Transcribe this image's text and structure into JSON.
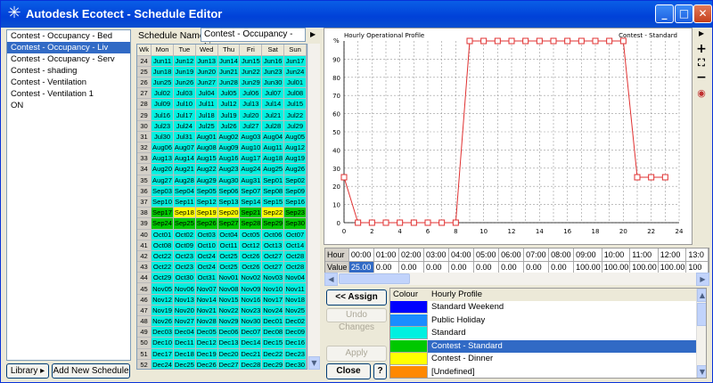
{
  "window": {
    "title": "Autodesk Ecotect - Schedule Editor"
  },
  "schedules": {
    "items": [
      "Contest - Occupancy - Bed",
      "Contest - Occupancy - Liv",
      "Contest - Occupancy - Serv",
      "Contest - shading",
      "Contest - Ventilation",
      "Contest - Ventilation 1",
      "ON"
    ],
    "selected_index": 1
  },
  "buttons": {
    "library": "Library ▸",
    "add_new": "Add New Schedule",
    "assign": "<< Assign",
    "undo": "Undo Changes",
    "apply": "Apply",
    "close": "Close",
    "help": "?"
  },
  "schedule_name": {
    "label": "Schedule Name:",
    "value": "Contest - Occupancy - Liv"
  },
  "calendar": {
    "headers": [
      "Wk",
      "Mon",
      "Tue",
      "Wed",
      "Thu",
      "Fri",
      "Sat",
      "Sun"
    ],
    "rows": [
      [
        "24",
        "Jun11",
        "Jun12",
        "Jun13",
        "Jun14",
        "Jun15",
        "Jun16",
        "Jun17"
      ],
      [
        "25",
        "Jun18",
        "Jun19",
        "Jun20",
        "Jun21",
        "Jun22",
        "Jun23",
        "Jun24"
      ],
      [
        "26",
        "Jun25",
        "Jun26",
        "Jun27",
        "Jun28",
        "Jun29",
        "Jun30",
        "Jul01"
      ],
      [
        "27",
        "Jul02",
        "Jul03",
        "Jul04",
        "Jul05",
        "Jul06",
        "Jul07",
        "Jul08"
      ],
      [
        "28",
        "Jul09",
        "Jul10",
        "Jul11",
        "Jul12",
        "Jul13",
        "Jul14",
        "Jul15"
      ],
      [
        "29",
        "Jul16",
        "Jul17",
        "Jul18",
        "Jul19",
        "Jul20",
        "Jul21",
        "Jul22"
      ],
      [
        "30",
        "Jul23",
        "Jul24",
        "Jul25",
        "Jul26",
        "Jul27",
        "Jul28",
        "Jul29"
      ],
      [
        "31",
        "Jul30",
        "Jul31",
        "Aug01",
        "Aug02",
        "Aug03",
        "Aug04",
        "Aug05"
      ],
      [
        "32",
        "Aug06",
        "Aug07",
        "Aug08",
        "Aug09",
        "Aug10",
        "Aug11",
        "Aug12"
      ],
      [
        "33",
        "Aug13",
        "Aug14",
        "Aug15",
        "Aug16",
        "Aug17",
        "Aug18",
        "Aug19"
      ],
      [
        "34",
        "Aug20",
        "Aug21",
        "Aug22",
        "Aug23",
        "Aug24",
        "Aug25",
        "Aug26"
      ],
      [
        "35",
        "Aug27",
        "Aug28",
        "Aug29",
        "Aug30",
        "Aug31",
        "Sep01",
        "Sep02"
      ],
      [
        "36",
        "Sep03",
        "Sep04",
        "Sep05",
        "Sep06",
        "Sep07",
        "Sep08",
        "Sep09"
      ],
      [
        "37",
        "Sep10",
        "Sep11",
        "Sep12",
        "Sep13",
        "Sep14",
        "Sep15",
        "Sep16"
      ],
      [
        "38",
        "Sep17",
        "Sep18",
        "Sep19",
        "Sep20",
        "Sep21",
        "Sep22",
        "Sep23"
      ],
      [
        "39",
        "Sep24",
        "Sep25",
        "Sep26",
        "Sep27",
        "Sep28",
        "Sep29",
        "Sep30"
      ],
      [
        "40",
        "Oct01",
        "Oct02",
        "Oct03",
        "Oct04",
        "Oct05",
        "Oct06",
        "Oct07"
      ],
      [
        "41",
        "Oct08",
        "Oct09",
        "Oct10",
        "Oct11",
        "Oct12",
        "Oct13",
        "Oct14"
      ],
      [
        "42",
        "Oct22",
        "Oct23",
        "Oct24",
        "Oct25",
        "Oct26",
        "Oct27",
        "Oct28"
      ],
      [
        "43",
        "Oct22",
        "Oct23",
        "Oct24",
        "Oct25",
        "Oct26",
        "Oct27",
        "Oct28"
      ],
      [
        "44",
        "Oct29",
        "Oct30",
        "Oct31",
        "Nov01",
        "Nov02",
        "Nov03",
        "Nov04"
      ],
      [
        "45",
        "Nov05",
        "Nov06",
        "Nov07",
        "Nov08",
        "Nov09",
        "Nov10",
        "Nov11"
      ],
      [
        "46",
        "Nov12",
        "Nov13",
        "Nov14",
        "Nov15",
        "Nov16",
        "Nov17",
        "Nov18"
      ],
      [
        "47",
        "Nov19",
        "Nov20",
        "Nov21",
        "Nov22",
        "Nov23",
        "Nov24",
        "Nov25"
      ],
      [
        "48",
        "Nov26",
        "Nov27",
        "Nov28",
        "Nov29",
        "Nov30",
        "Dec01",
        "Dec02"
      ],
      [
        "49",
        "Dec03",
        "Dec04",
        "Dec05",
        "Dec06",
        "Dec07",
        "Dec08",
        "Dec09"
      ],
      [
        "50",
        "Dec10",
        "Dec11",
        "Dec12",
        "Dec13",
        "Dec14",
        "Dec15",
        "Dec16"
      ],
      [
        "51",
        "Dec17",
        "Dec18",
        "Dec19",
        "Dec20",
        "Dec21",
        "Dec22",
        "Dec23"
      ],
      [
        "52",
        "Dec24",
        "Dec25",
        "Dec26",
        "Dec27",
        "Dec28",
        "Dec29",
        "Dec30"
      ],
      [
        "53",
        "Dec31",
        "",
        "",
        "",
        "",
        "",
        ""
      ]
    ],
    "row_colors": {
      "default": "#00f0e0",
      "38": [
        "#00c800",
        "#ffff00",
        "#ffff00",
        "#ffff00",
        "#00c800",
        "#ffff00",
        "#00c800"
      ],
      "39": [
        "#00c800",
        "#00c800",
        "#00c800",
        "#00c800",
        "#00c800",
        "#00c800",
        "#00c800"
      ]
    }
  },
  "chart_data": {
    "type": "line",
    "title": "Hourly Operational Profile",
    "series": [
      {
        "name": "Contest - Standard",
        "x": [
          0,
          1,
          2,
          3,
          4,
          5,
          6,
          7,
          8,
          9,
          10,
          11,
          12,
          13,
          14,
          15,
          16,
          17,
          18,
          19,
          20,
          21,
          22,
          23
        ],
        "values": [
          25,
          0,
          0,
          0,
          0,
          0,
          0,
          0,
          0,
          100,
          100,
          100,
          100,
          100,
          100,
          100,
          100,
          100,
          100,
          100,
          100,
          25,
          25,
          25
        ]
      }
    ],
    "ylabel": "%",
    "xlim": [
      0,
      24
    ],
    "ylim": [
      0,
      100
    ],
    "xticks": [
      0,
      2,
      4,
      6,
      8,
      10,
      12,
      14,
      16,
      18,
      20,
      22,
      24
    ],
    "yticks": [
      0,
      10,
      20,
      30,
      40,
      50,
      60,
      70,
      80,
      90
    ],
    "grid": true,
    "legend": "top-right",
    "color": "#e03030"
  },
  "hour_grid": {
    "row_labels": [
      "Hour",
      "Value"
    ],
    "hours": [
      "00:00",
      "01:00",
      "02:00",
      "03:00",
      "04:00",
      "05:00",
      "06:00",
      "07:00",
      "08:00",
      "09:00",
      "10:00",
      "11:00",
      "12:00",
      "13:0"
    ],
    "values": [
      "25.00",
      "0.00",
      "0.00",
      "0.00",
      "0.00",
      "0.00",
      "0.00",
      "0.00",
      "0.00",
      "100.00",
      "100.00",
      "100.00",
      "100.00",
      "100"
    ]
  },
  "profiles": {
    "headers": [
      "Colour",
      "Hourly Profile"
    ],
    "items": [
      {
        "label": "Standard Weekend",
        "color": "#0000ff"
      },
      {
        "label": "Public Holiday",
        "color": "#1a8cff"
      },
      {
        "label": "Standard",
        "color": "#00f0e0"
      },
      {
        "label": "Contest - Standard",
        "color": "#00c800"
      },
      {
        "label": "Contest - Dinner",
        "color": "#ffff00"
      },
      {
        "label": "[Undefined]",
        "color": "#ff8800"
      }
    ],
    "selected_index": 3
  }
}
